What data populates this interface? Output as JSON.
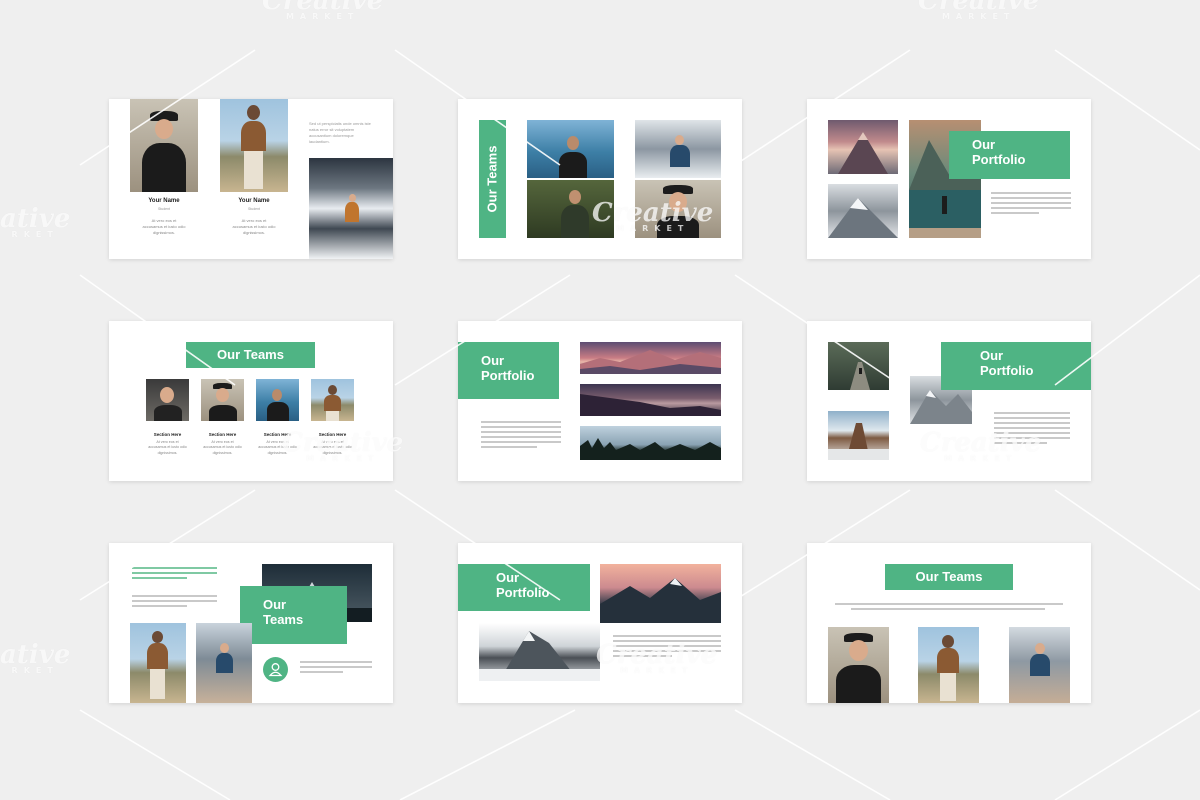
{
  "colors": {
    "accent": "#4fb484",
    "background": "#efefef",
    "slide": "#ffffff"
  },
  "watermark": {
    "brand": "Creative",
    "sub": "MARKET",
    "edge": "ative",
    "edge_sub": "RKET"
  },
  "slide1": {
    "member1": {
      "name": "Your Name",
      "role": "Student",
      "bio": [
        "At vero eos et",
        "accusamus et iusto odio",
        "dignissimos."
      ]
    },
    "member2": {
      "name": "Your Name",
      "role": "Student",
      "bio": [
        "At vero eos et",
        "accusamus et iusto odio",
        "dignissimos."
      ]
    },
    "side_text": [
      "Sed ut perspiciatis unde omnis iste",
      "natus error sit voluptatem",
      "accusantium doloremque",
      "laudantium."
    ]
  },
  "slide2": {
    "title": "Our Teams"
  },
  "slide3": {
    "title_line1": "Our",
    "title_line2": "Portfolio"
  },
  "slide4": {
    "title": "Our Teams",
    "members": [
      {
        "label": "Section Here",
        "bio": [
          "At vero eos et",
          "accusamus et iusto odio",
          "dignissimos."
        ]
      },
      {
        "label": "Section Here",
        "bio": [
          "At vero eos et",
          "accusamus et iusto odio",
          "dignissimos."
        ]
      },
      {
        "label": "Section Here",
        "bio": [
          "At vero eos et",
          "accusamus et iusto odio",
          "dignissimos."
        ]
      },
      {
        "label": "Section Here",
        "bio": [
          "At vero eos et",
          "accusamus et iusto odio",
          "dignissimos."
        ]
      }
    ]
  },
  "slide5": {
    "title_line1": "Our",
    "title_line2": "Portfolio"
  },
  "slide6": {
    "title_line1": "Our",
    "title_line2": "Portfolio"
  },
  "slide7": {
    "title_line1": "Our",
    "title_line2": "Teams",
    "icon": "user-icon"
  },
  "slide8": {
    "title_line1": "Our",
    "title_line2": "Portfolio"
  },
  "slide9": {
    "title": "Our Teams"
  }
}
